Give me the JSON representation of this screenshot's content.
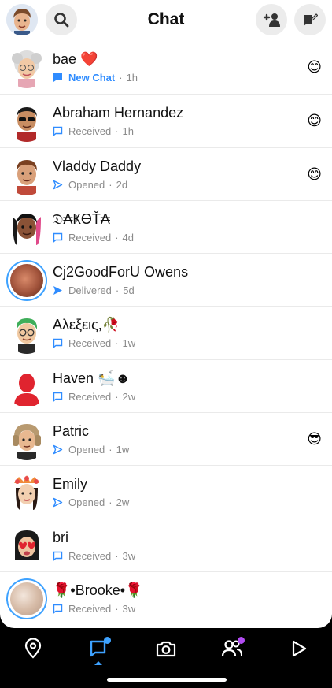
{
  "header": {
    "title": "Chat"
  },
  "colors": {
    "accent_blue": "#3ea2ff",
    "chat_blue": "#2f8cff",
    "badge_purple": "#b24cf2",
    "nav_bg": "#000000"
  },
  "chats": [
    {
      "name": "bae ❤️",
      "status": "New Chat",
      "time": "1h",
      "icon": "chat-filled-icon",
      "emoji": "😊"
    },
    {
      "name": "Abraham Hernandez",
      "status": "Received",
      "time": "1h",
      "icon": "chat-outline-icon",
      "emoji": "😊"
    },
    {
      "name": "Vladdy Daddy",
      "status": "Opened",
      "time": "2d",
      "icon": "arrow-outline-icon",
      "emoji": "😊"
    },
    {
      "name": "𝔇₳ҜӨŤ₳",
      "status": "Received",
      "time": "4d",
      "icon": "chat-outline-icon",
      "emoji": ""
    },
    {
      "name": "Cj2GoodForU Owens",
      "status": "Delivered",
      "time": "5d",
      "icon": "arrow-filled-icon",
      "emoji": ""
    },
    {
      "name": "Αλεξεις,🥀",
      "status": "Received",
      "time": "1w",
      "icon": "chat-outline-icon",
      "emoji": ""
    },
    {
      "name": "Haven 🛀☻",
      "status": "Received",
      "time": "2w",
      "icon": "chat-outline-icon",
      "emoji": ""
    },
    {
      "name": "Patric",
      "status": "Opened",
      "time": "1w",
      "icon": "arrow-outline-icon",
      "emoji": "😎"
    },
    {
      "name": "Emily",
      "status": "Opened",
      "time": "2w",
      "icon": "arrow-outline-icon",
      "emoji": ""
    },
    {
      "name": "bri",
      "status": "Received",
      "time": "3w",
      "icon": "chat-outline-icon",
      "emoji": ""
    },
    {
      "name": "🌹•Brooke•🌹",
      "status": "Received",
      "time": "3w",
      "icon": "chat-outline-icon",
      "emoji": ""
    }
  ],
  "nav": {
    "items": [
      "map-pin-icon",
      "chat-icon",
      "camera-icon",
      "friends-icon",
      "play-icon"
    ],
    "active": "chat-icon"
  }
}
